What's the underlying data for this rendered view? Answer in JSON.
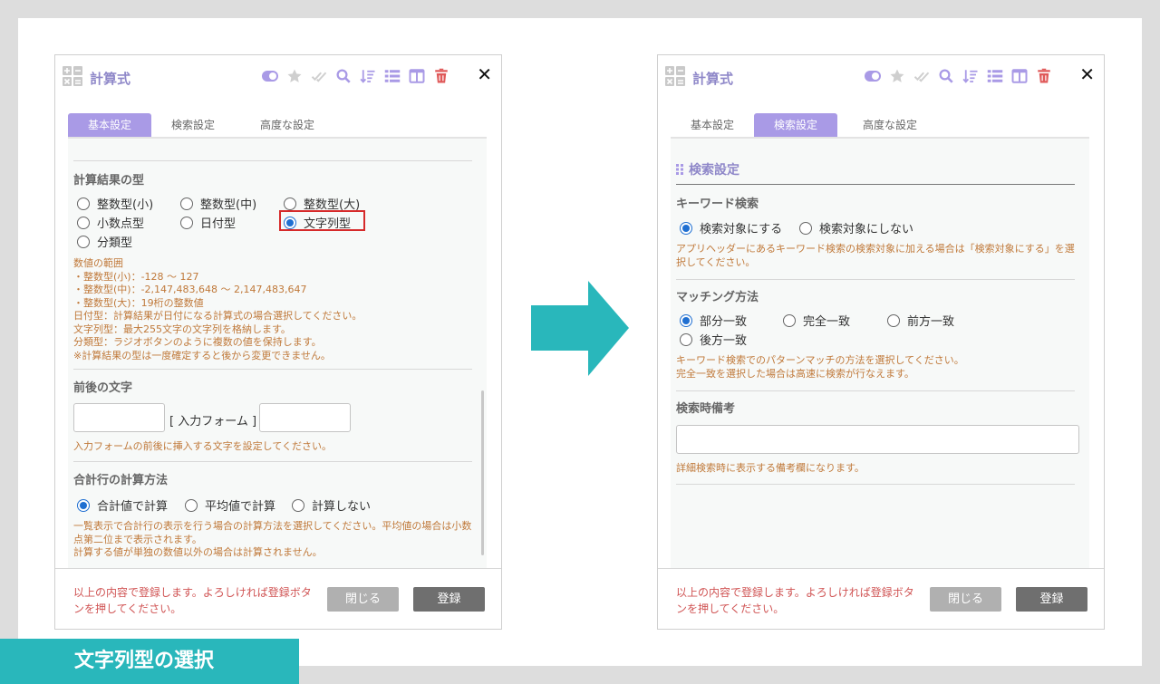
{
  "panel_title": "計算式",
  "tabs": [
    "基本設定",
    "検索設定",
    "高度な設定"
  ],
  "left": {
    "calc_result_type": {
      "title": "計算結果の型",
      "options": [
        "整数型(小)",
        "整数型(中)",
        "整数型(大)",
        "小数点型",
        "日付型",
        "文字列型",
        "分類型"
      ],
      "selected": "文字列型",
      "note_lines": [
        "数値の範囲",
        "・整数型(小)：-128 〜 127",
        "・整数型(中)：-2,147,483,648 〜 2,147,483,647",
        "・整数型(大)：19桁の整数値",
        "日付型：計算結果が日付になる計算式の場合選択してください。",
        "文字列型：最大255文字の文字列を格納します。",
        "分類型：ラジオボタンのように複数の値を保持します。",
        "※計算結果の型は一度確定すると後から変更できません。"
      ]
    },
    "affix": {
      "title": "前後の文字",
      "input_form_label": "[ 入力フォーム ]",
      "prefix_value": "",
      "suffix_value": "",
      "note": "入力フォームの前後に挿入する文字を設定してください。"
    },
    "total_row": {
      "title": "合計行の計算方法",
      "options": [
        "合計値で計算",
        "平均値で計算",
        "計算しない"
      ],
      "selected": "合計値で計算",
      "note_lines": [
        "一覧表示で合計行の表示を行う場合の計算方法を選択してください。平均値の場合は小数",
        "点第二位まで表示されます。",
        "計算する値が単独の数値以外の場合は計算されません。"
      ]
    }
  },
  "right": {
    "section_title": "検索設定",
    "keyword": {
      "title": "キーワード検索",
      "options": [
        "検索対象にする",
        "検索対象にしない"
      ],
      "selected": "検索対象にする",
      "note_lines": [
        "アプリヘッダーにあるキーワード検索の検索対象に加える場合は「検索対象にする」を選",
        "択してください。"
      ]
    },
    "matching": {
      "title": "マッチング方法",
      "options": [
        "部分一致",
        "完全一致",
        "前方一致",
        "後方一致"
      ],
      "selected": "部分一致",
      "note_lines": [
        "キーワード検索でのパターンマッチの方法を選択してください。",
        "完全一致を選択した場合は高速に検索が行なえます。"
      ]
    },
    "remarks": {
      "title": "検索時備考",
      "value": "",
      "note": "詳細検索時に表示する備考欄になります。"
    }
  },
  "footer": {
    "message_line1": "以上の内容で登録します。よろしければ登録ボタ",
    "message_line2": "ンを押してください。",
    "close_label": "閉じる",
    "save_label": "登録"
  },
  "caption": "文字列型の選択",
  "colors": {
    "accent": "#a99ae6",
    "title": "#8f88c9",
    "note": "#c0793a",
    "highlight": "#d62a2a",
    "arrow": "#29b7bb",
    "delete": "#e05a5a"
  },
  "icons": [
    "calculator-icon",
    "toggle-icon",
    "star-icon",
    "double-check-icon",
    "search-icon",
    "sort-icon",
    "list-icon",
    "columns-icon",
    "trash-icon",
    "close-icon",
    "grip-icon",
    "arrow-right-icon"
  ]
}
